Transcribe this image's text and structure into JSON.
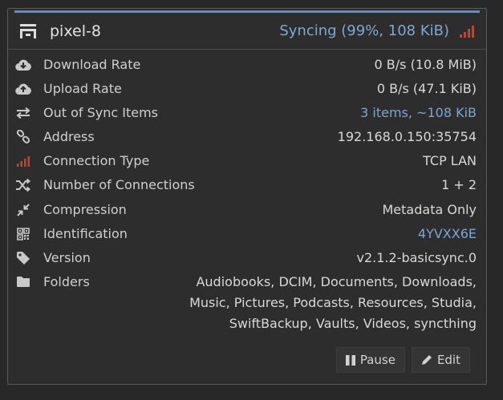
{
  "device": {
    "name": "pixel-8",
    "status": "Syncing (99%, 108 KiB)",
    "icon": "device-icon",
    "colors": {
      "accent": "#5e8fbf",
      "link": "#79a6d2",
      "signal": "#b4483a"
    }
  },
  "rows": [
    {
      "key": "download",
      "icon": "cloud-download-icon",
      "label": "Download Rate",
      "value": "0 B/s (10.8 MiB)"
    },
    {
      "key": "upload",
      "icon": "cloud-upload-icon",
      "label": "Upload Rate",
      "value": "0 B/s (47.1 KiB)"
    },
    {
      "key": "out-of-sync",
      "icon": "swap-arrows-icon",
      "label": "Out of Sync Items",
      "value": "3 items, ~108 KiB"
    },
    {
      "key": "address",
      "icon": "link-icon",
      "label": "Address",
      "value": "192.168.0.150:35754"
    },
    {
      "key": "connection-type",
      "icon": "signal-bars-icon",
      "label": "Connection Type",
      "value": "TCP LAN"
    },
    {
      "key": "connections",
      "icon": "shuffle-icon",
      "label": "Number of Connections",
      "value": "1 + 2"
    },
    {
      "key": "compression",
      "icon": "compress-icon",
      "label": "Compression",
      "value": "Metadata Only"
    },
    {
      "key": "identification",
      "icon": "qr-code-icon",
      "label": "Identification",
      "value": "4YVXX6E"
    },
    {
      "key": "version",
      "icon": "tag-icon",
      "label": "Version",
      "value": "v2.1.2-basicsync.0"
    },
    {
      "key": "folders",
      "icon": "folder-icon",
      "label": "Folders",
      "value": "Audiobooks, DCIM, Documents, Downloads, Music, Pictures, Podcasts, Resources, Studia, SwiftBackup, Vaults, Videos, syncthing"
    }
  ],
  "actions": {
    "pause_label": "Pause",
    "edit_label": "Edit"
  }
}
